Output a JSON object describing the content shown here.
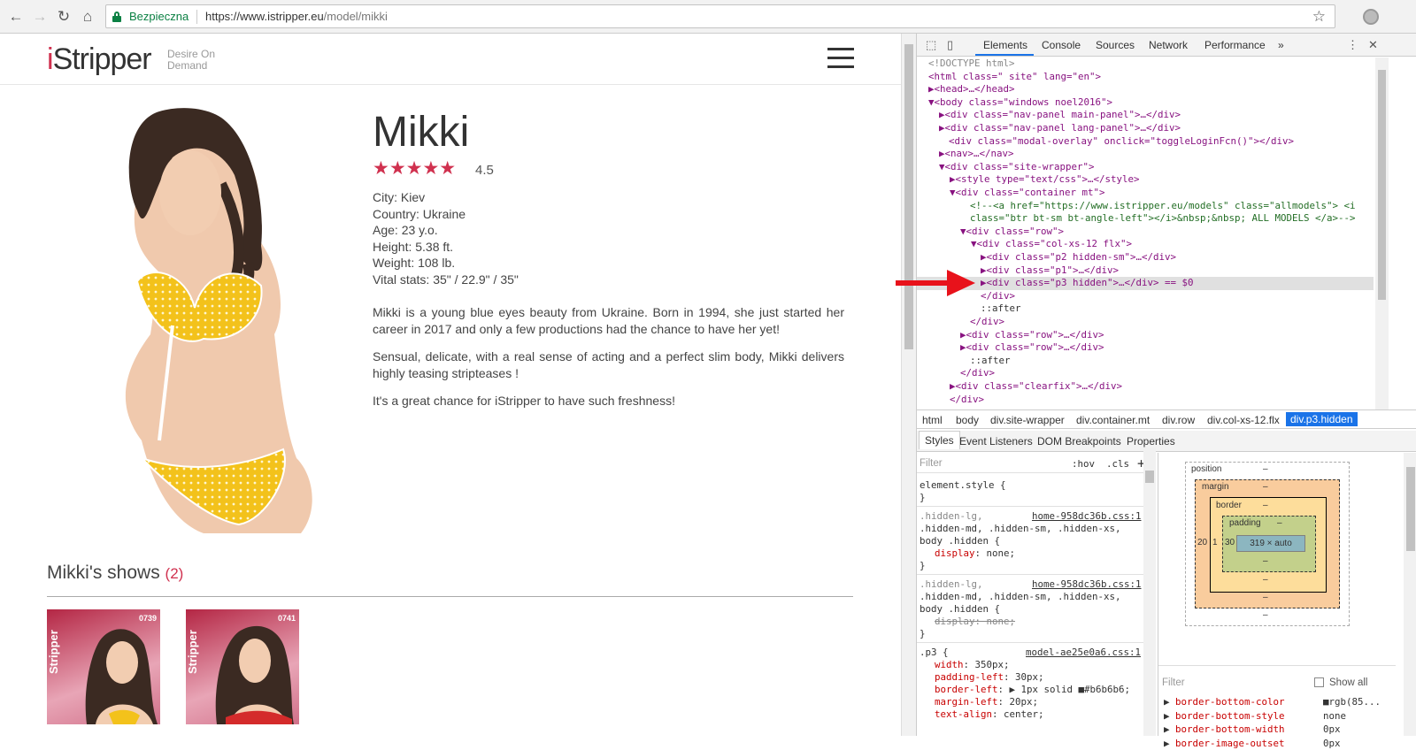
{
  "browser": {
    "secure_label": "Bezpieczna",
    "url_host": "https://www.istripper.eu",
    "url_path": "/model/mikki"
  },
  "site": {
    "logo_i": "i",
    "logo_rest": "Stripper",
    "tagline": "Desire On Demand",
    "model": {
      "name": "Mikki",
      "rating": "4.5",
      "stars_fraction": 0.9,
      "facts": [
        "City: Kiev",
        "Country: Ukraine",
        "Age: 23 y.o.",
        "Height: 5.38 ft.",
        "Weight: 108 lb.",
        "Vital stats: 35\" / 22.9\" / 35\""
      ],
      "description": [
        "Mikki is a young blue eyes beauty from Ukraine. Born in 1994, she just started her career in 2017 and only a few productions had the chance to have her yet!",
        "Sensual, delicate, with a real sense of acting and a perfect slim body, Mikki delivers highly teasing stripteases !",
        "It's a great chance for iStripper to have such freshness!"
      ]
    },
    "shows": {
      "title": "Mikki's shows",
      "count": "(2)",
      "cards": [
        {
          "number": "0739",
          "brand": "Stripper"
        },
        {
          "number": "0741",
          "brand": "Stripper"
        }
      ]
    }
  },
  "devtools": {
    "tabs": [
      "Elements",
      "Console",
      "Sources",
      "Network",
      "Performance"
    ],
    "more": "»",
    "dom_lines": [
      "<!DOCTYPE html>",
      "<html class=\" site\" lang=\"en\">",
      "▶<head>…</head>",
      "▼<body class=\"windows noel2016\">",
      "▶<div class=\"nav-panel main-panel\">…</div>",
      "▶<div class=\"nav-panel lang-panel\">…</div>",
      "<div class=\"modal-overlay\" onclick=\"toggleLoginFcn()\"></div>",
      "▶<nav>…</nav>",
      "▼<div class=\"site-wrapper\">",
      "▶<style type=\"text/css\">…</style>",
      "▼<div class=\"container mt\">",
      "<!--<a href=\"https://www.istripper.eu/models\" class=\"allmodels\"> <i",
      "class=\"btr bt-sm bt-angle-left\"></i>&nbsp;&nbsp; ALL MODELS </a>-->",
      "▼<div class=\"row\">",
      "▼<div class=\"col-xs-12 flx\">",
      "▶<div class=\"p2 hidden-sm\">…</div>",
      "▶<div class=\"p1\">…</div>",
      "▶<div class=\"p3 hidden\">…</div> == $0",
      "</div>",
      "::after",
      "</div>",
      "▶<div class=\"row\">…</div>",
      "▶<div class=\"row\">…</div>",
      "::after",
      "</div>",
      "▶<div class=\"clearfix\">…</div>",
      "</div>"
    ],
    "breadcrumbs": [
      "html",
      "body",
      "div.site-wrapper",
      "div.container.mt",
      "div.row",
      "div.col-xs-12.flx",
      "div.p3.hidden"
    ],
    "subtabs": [
      "Styles",
      "Event Listeners",
      "DOM Breakpoints",
      "Properties"
    ],
    "styles": {
      "filter": "Filter",
      "hov": ":hov",
      "cls": ".cls",
      "plus": "+",
      "element_style": "element.style {",
      "close": "}",
      "rule1_sel1": ".hidden-lg,",
      "rule1_src": "home-958dc36b.css:1",
      "rule1_sel2": ".hidden-md, .hidden-sm, .hidden-xs,",
      "rule1_sel3": "body .hidden {",
      "rule1_prop": "display",
      "rule1_val": "none;",
      "rule2_struck": "display: none;",
      "p3_sel": ".p3 {",
      "p3_src": "model-ae25e0a6.css:1",
      "p3_props": [
        {
          "name": "width",
          "value": "350px;"
        },
        {
          "name": "padding-left",
          "value": "30px;"
        },
        {
          "name": "border-left",
          "value": "▶ 1px solid ■#b6b6b6;"
        },
        {
          "name": "margin-left",
          "value": "20px;"
        },
        {
          "name": "text-align",
          "value": "center;"
        }
      ]
    },
    "boxmodel": {
      "position": "position",
      "margin": "margin",
      "border": "border",
      "padding": "padding",
      "content": "319 × auto",
      "dash": "–",
      "margin_left": "20",
      "border_left": "1",
      "padding_left": "30"
    },
    "computed": {
      "filter": "Filter",
      "show_all": "Show all",
      "props": [
        {
          "name": "border-bottom-color",
          "value": "■rgb(85..."
        },
        {
          "name": "border-bottom-style",
          "value": "none"
        },
        {
          "name": "border-bottom-width",
          "value": "0px"
        },
        {
          "name": "border-image-outset",
          "value": "0px"
        }
      ]
    }
  }
}
